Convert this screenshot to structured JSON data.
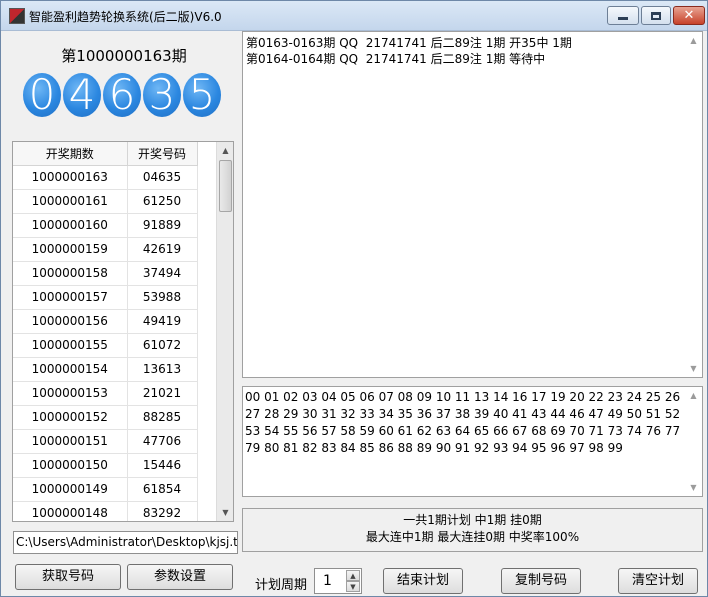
{
  "window": {
    "title": "智能盈利趋势轮换系统(后二版)V6.0"
  },
  "left": {
    "period_heading": "第1000000163期",
    "balls": [
      "0",
      "4",
      "6",
      "3",
      "5"
    ],
    "table": {
      "headers": [
        "开奖期数",
        "开奖号码"
      ],
      "rows": [
        [
          "1000000163",
          "04635"
        ],
        [
          "1000000161",
          "61250"
        ],
        [
          "1000000160",
          "91889"
        ],
        [
          "1000000159",
          "42619"
        ],
        [
          "1000000158",
          "37494"
        ],
        [
          "1000000157",
          "53988"
        ],
        [
          "1000000156",
          "49419"
        ],
        [
          "1000000155",
          "61072"
        ],
        [
          "1000000154",
          "13613"
        ],
        [
          "1000000153",
          "21021"
        ],
        [
          "1000000152",
          "88285"
        ],
        [
          "1000000151",
          "47706"
        ],
        [
          "1000000150",
          "15446"
        ],
        [
          "1000000149",
          "61854"
        ],
        [
          "1000000148",
          "83292"
        ]
      ]
    },
    "path_value": "C:\\Users\\Administrator\\Desktop\\kjsj.txt",
    "fetch_button": "获取号码",
    "settings_button": "参数设置"
  },
  "right": {
    "log_lines": [
      "第0163-0163期 QQ  21741741 后二89注 1期 开35中 1期",
      "第0164-0164期 QQ  21741741 后二89注 1期 等待中"
    ],
    "numbers_text": "00 01 02 03 04 05 06 07 08 09 10 11 13 14 16 17 19 20 22 23 24 25 26 27 28 29 30 31 32 33 34 35 36 37 38 39 40 41 43 44 46 47 49 50 51 52 53 54 55 56 57 58 59 60 61 62 63 64 65 66 67 68 69 70 71 73 74 76 77 79 80 81 82 83 84 85 86 88 89 90 91 92 93 94 95 96 97 98 99",
    "summary_line1": "一共1期计划  中1期  挂0期",
    "summary_line2": "最大连中1期  最大连挂0期  中奖率100%",
    "cycle_label": "计划周期",
    "cycle_value": "1",
    "end_button": "结束计划",
    "copy_button": "复制号码",
    "clear_button": "清空计划"
  }
}
